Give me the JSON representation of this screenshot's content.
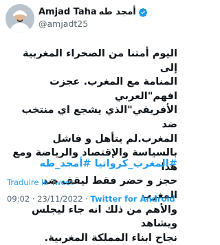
{
  "author": {
    "display_name": "Amjad Taha",
    "display_name_ar": "أمجد طه",
    "handle": "@amjadt25",
    "verified": true,
    "avatar_icon": "profile-photo"
  },
  "tweet": {
    "text": "اليوم أمتنا من الصحراء المغربية إلى\nالمنامة مع المغرب. عجزت افهم\"العربي\nالأفريقي\"الذي يشجع اي منتخب ضد\nالمغرب.لم يتأهل و فاشل\nبالسياسة والإقتصاد والرياضة ومع هذا\nحجز و حضر فقط ليقف ضد المغرب\nوالأهم من ذلك انه جاء ليجلس ويشاهد\nنجاح ابناء المملكة المغربية.",
    "hashtags": [
      "#المغرب_كرواتيا",
      "#أمجد_طه"
    ],
    "translate_label": "Traduire le Tweet",
    "time": "09:02",
    "date": "23/11/2022",
    "source": "Twitter for Android"
  },
  "colors": {
    "link": "#1d9bf0",
    "text": "#0f1419",
    "secondary": "#536471"
  }
}
